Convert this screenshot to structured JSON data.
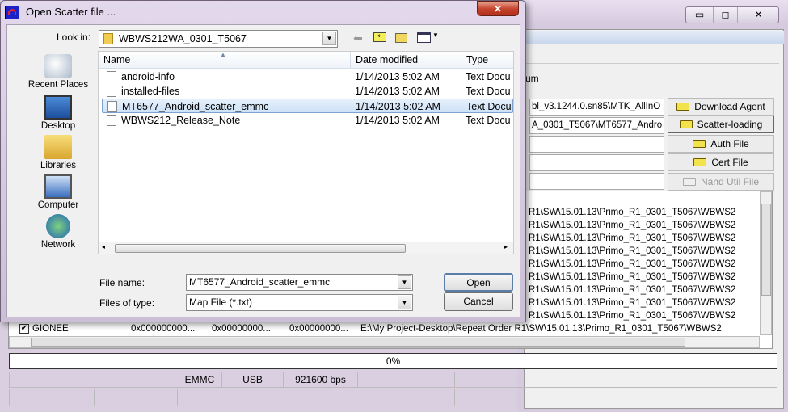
{
  "bg_window": {
    "controls": {
      "minimize": "▭",
      "restore": "◻",
      "close": "✕"
    },
    "partial_label": "um",
    "fields": [
      "bl_v3.1244.0.sn85\\MTK_AllInO",
      "A_0301_T5067\\MT6577_Andro",
      "",
      "",
      ""
    ],
    "buttons": [
      {
        "label": "Download Agent",
        "enabled": true
      },
      {
        "label": "Scatter-loading",
        "enabled": true
      },
      {
        "label": "Auth File",
        "enabled": true
      },
      {
        "label": "Cert File",
        "enabled": true
      },
      {
        "label": "Nand Util File",
        "enabled": false
      }
    ],
    "list_rows_partial": [
      "R1\\SW\\15.01.13\\Primo_R1_0301_T5067\\WBWS2",
      "R1\\SW\\15.01.13\\Primo_R1_0301_T5067\\WBWS2",
      "R1\\SW\\15.01.13\\Primo_R1_0301_T5067\\WBWS2",
      "R1\\SW\\15.01.13\\Primo_R1_0301_T5067\\WBWS2",
      "R1\\SW\\15.01.13\\Primo_R1_0301_T5067\\WBWS2",
      "R1\\SW\\15.01.13\\Primo_R1_0301_T5067\\WBWS2",
      "R1\\SW\\15.01.13\\Primo_R1_0301_T5067\\WBWS2",
      "R1\\SW\\15.01.13\\Primo_R1_0301_T5067\\WBWS2",
      "R1\\SW\\15.01.13\\Primo_R1_0301_T5067\\WBWS2"
    ],
    "last_row": {
      "checked": true,
      "name": "GIONEE",
      "begin": "0x000000000...",
      "end": "0x00000000...",
      "addr": "0x00000000...",
      "path": "E:\\My Project-Desktop\\Repeat Order R1\\SW\\15.01.13\\Primo_R1_0301_T5067\\WBWS2"
    },
    "progress_text": "0%",
    "progress": 0,
    "status": {
      "storage": "EMMC",
      "port": "USB",
      "baud": "921600 bps"
    }
  },
  "dialog": {
    "title": "Open Scatter file ...",
    "look_in_label": "Look in:",
    "look_in_value": "WBWS212WA_0301_T5067",
    "places": [
      "Recent Places",
      "Desktop",
      "Libraries",
      "Computer",
      "Network"
    ],
    "columns": [
      "Name",
      "Date modified",
      "Type"
    ],
    "files": [
      {
        "name": "android-info",
        "date": "1/14/2013 5:02 AM",
        "type": "Text Docu",
        "selected": false
      },
      {
        "name": "installed-files",
        "date": "1/14/2013 5:02 AM",
        "type": "Text Docu",
        "selected": false
      },
      {
        "name": "MT6577_Android_scatter_emmc",
        "date": "1/14/2013 5:02 AM",
        "type": "Text Docu",
        "selected": true
      },
      {
        "name": "WBWS212_Release_Note",
        "date": "1/14/2013 5:02 AM",
        "type": "Text Docu",
        "selected": false
      }
    ],
    "file_name_label": "File name:",
    "file_name_value": "MT6577_Android_scatter_emmc",
    "file_type_label": "Files of type:",
    "file_type_value": "Map File (*.txt)",
    "open_label": "Open",
    "cancel_label": "Cancel",
    "close_label": "✕"
  }
}
